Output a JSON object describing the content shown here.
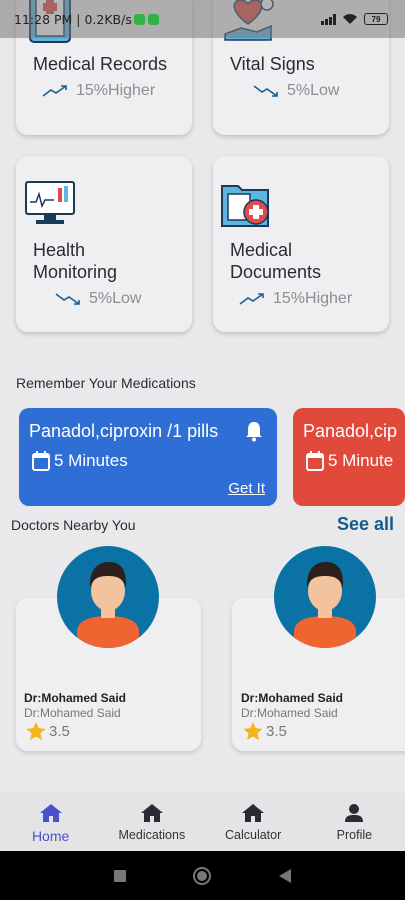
{
  "status_bar": {
    "time": "11:28 PM | 0.2KB/s",
    "battery": "79"
  },
  "cards": [
    {
      "title": "Medical Records",
      "trend": "15%Higher",
      "direction": "up"
    },
    {
      "title": "Vital Signs",
      "trend": "5%Low",
      "direction": "down"
    },
    {
      "title_line1": "Health",
      "title_line2": "Monitoring",
      "trend": "5%Low",
      "direction": "down"
    },
    {
      "title_line1": "Medical",
      "title_line2": "Documents",
      "trend": "15%Higher",
      "direction": "up"
    }
  ],
  "medications": {
    "section_title": "Remember Your Medications",
    "items": [
      {
        "name": "Panadol,ciproxin /1 pills",
        "time": "5 Minutes",
        "action": "Get It",
        "color": "#2f6fd5"
      },
      {
        "name": "Panadol,cip",
        "time": "5 Minute",
        "color": "#e14a3a"
      }
    ]
  },
  "doctors": {
    "section_title": "Doctors Nearby You",
    "see_all": "See all",
    "items": [
      {
        "name": "Dr:Mohamed Said",
        "subtitle": "Dr:Mohamed Said",
        "rating": "3.5"
      },
      {
        "name": "Dr:Mohamed Said",
        "subtitle": "Dr:Mohamed Said",
        "rating": "3.5"
      }
    ]
  },
  "nav": {
    "items": [
      {
        "label": "Home",
        "icon": "home-icon",
        "active": true
      },
      {
        "label": "Medications",
        "icon": "home-icon"
      },
      {
        "label": "Calculator",
        "icon": "home-icon"
      },
      {
        "label": "Profile",
        "icon": "profile-icon"
      }
    ]
  },
  "colors": {
    "accent": "#4a52c9",
    "see_all": "#155a8a",
    "avatar_bg": "#0a72a4"
  }
}
